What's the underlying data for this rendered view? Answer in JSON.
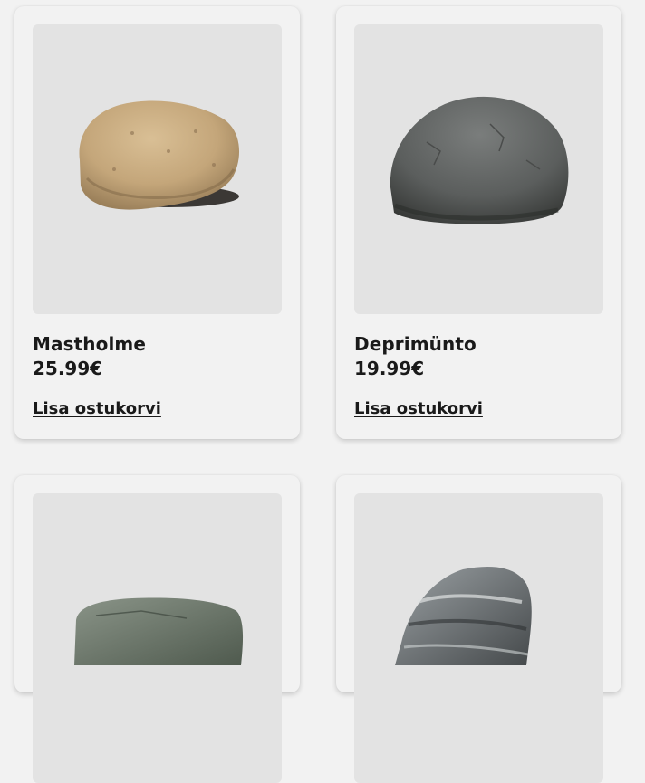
{
  "products": [
    {
      "name": "Mastholme",
      "price": "25.99€",
      "cart_label": "Lisa ostukorvi",
      "image": "tan-granite-rock"
    },
    {
      "name": "Deprimünto",
      "price": "19.99€",
      "cart_label": "Lisa ostukorvi",
      "image": "dark-grey-boulder"
    },
    {
      "image": "flat-green-stone"
    },
    {
      "image": "banded-grey-rock"
    }
  ]
}
